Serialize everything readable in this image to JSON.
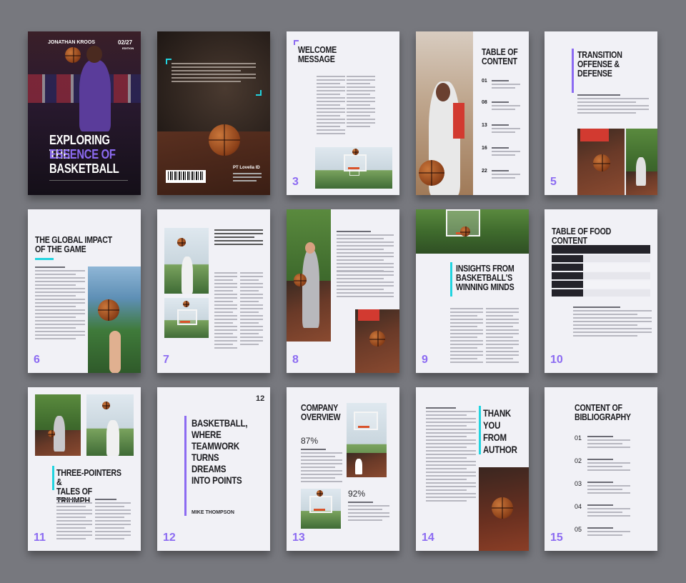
{
  "colors": {
    "accent_purple": "#8c6bf2",
    "accent_cyan": "#21d4e0",
    "background": "#77787e",
    "page": "#f1f1f6"
  },
  "cover": {
    "author": "JONATHAN KROOS",
    "issue": "02/27",
    "edition": "EDITION",
    "title_line1": "EXPLORING THE",
    "title_line2": "ESSENCE OF",
    "title_line3": "BASKETBALL"
  },
  "back_cover": {
    "publisher": "PT Lovelia ID"
  },
  "pages": {
    "p3": {
      "title": "WELCOME\nMESSAGE",
      "number": "3"
    },
    "p4": {
      "title": "TABLE OF\nCONTENT",
      "items": [
        {
          "n": "01"
        },
        {
          "n": "08"
        },
        {
          "n": "13"
        },
        {
          "n": "16"
        },
        {
          "n": "22"
        }
      ]
    },
    "p5": {
      "title": "TRANSITION\nOFFENSE &\nDEFENSE",
      "number": "5"
    },
    "p6": {
      "title": "THE GLOBAL IMPACT\nOF THE GAME",
      "number": "6"
    },
    "p7": {
      "number": "7"
    },
    "p8": {
      "number": "8"
    },
    "p9": {
      "title": "INSIGHTS FROM\nBASKETBALL'S\nWINNING MINDS",
      "number": "9"
    },
    "p10": {
      "title": "TABLE OF FOOD CONTENT",
      "number": "10"
    },
    "p11": {
      "title": "THREE-POINTERS &\nTALES OF TRIUMPH",
      "number": "11"
    },
    "p12": {
      "title": "BASKETBALL,\nWHERE\nTEAMWORK\nTURNS\nDREAMS\nINTO POINTS",
      "author": "MIKE THOMPSON",
      "number": "12",
      "top_number": "12"
    },
    "p13": {
      "title": "COMPANY\nOVERVIEW",
      "stat1": "87%",
      "stat2": "92%",
      "number": "13"
    },
    "p14": {
      "title": "THANK\nYOU\nFROM\nAUTHOR",
      "number": "14"
    },
    "p15": {
      "title": "CONTENT OF\nBIBLIOGRAPHY",
      "items": [
        "01",
        "02",
        "03",
        "04",
        "05"
      ],
      "number": "15"
    }
  }
}
